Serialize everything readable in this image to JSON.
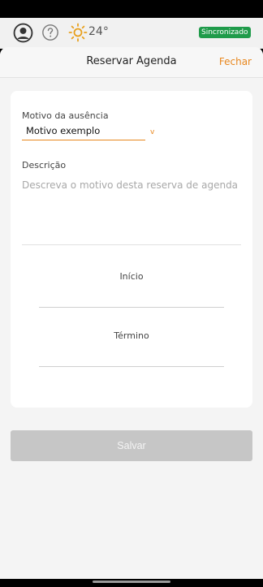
{
  "top_bar": {
    "temperature": "24°",
    "sync_status": "Sincronizado",
    "icons": [
      "user-circle-icon",
      "help-circle-icon",
      "sun-icon"
    ]
  },
  "sheet": {
    "title": "Reservar Agenda",
    "close_label": "Fechar"
  },
  "form": {
    "reason": {
      "label": "Motivo da ausência",
      "value": "Motivo exemplo"
    },
    "description": {
      "label": "Descrição",
      "placeholder": "Descreva o motivo desta reserva de agenda"
    },
    "start": {
      "label": "Início"
    },
    "end": {
      "label": "Término"
    },
    "save_label": "Salvar"
  },
  "colors": {
    "accent": "#e8871e",
    "sync_badge": "#1f9b4a",
    "disabled_button": "#c6c6c6"
  }
}
